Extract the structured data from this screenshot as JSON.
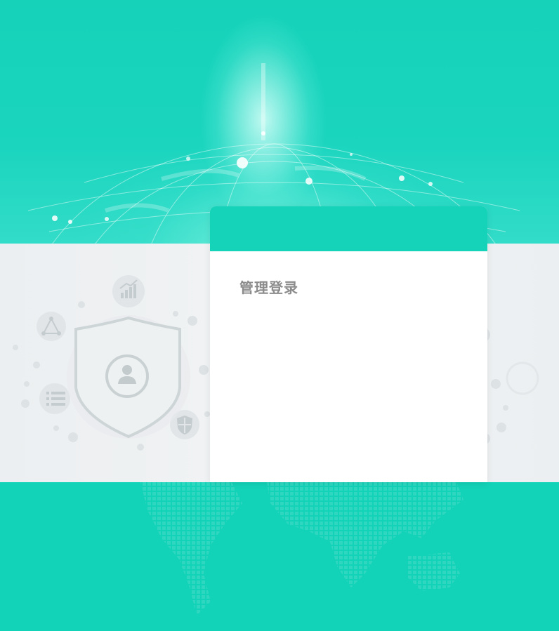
{
  "login": {
    "title": "管理登录"
  },
  "colors": {
    "accent": "#14d3b8",
    "band": "#f0f2f3",
    "card": "#ffffff",
    "title_text": "#8c8c8c"
  },
  "icons": {
    "hero": "glowing-globe",
    "illustration": "shield-user-icon",
    "satellites": [
      "chart-icon",
      "network-triangle-icon",
      "list-icon",
      "shield-small-icon"
    ],
    "footer": "world-map-dots"
  }
}
